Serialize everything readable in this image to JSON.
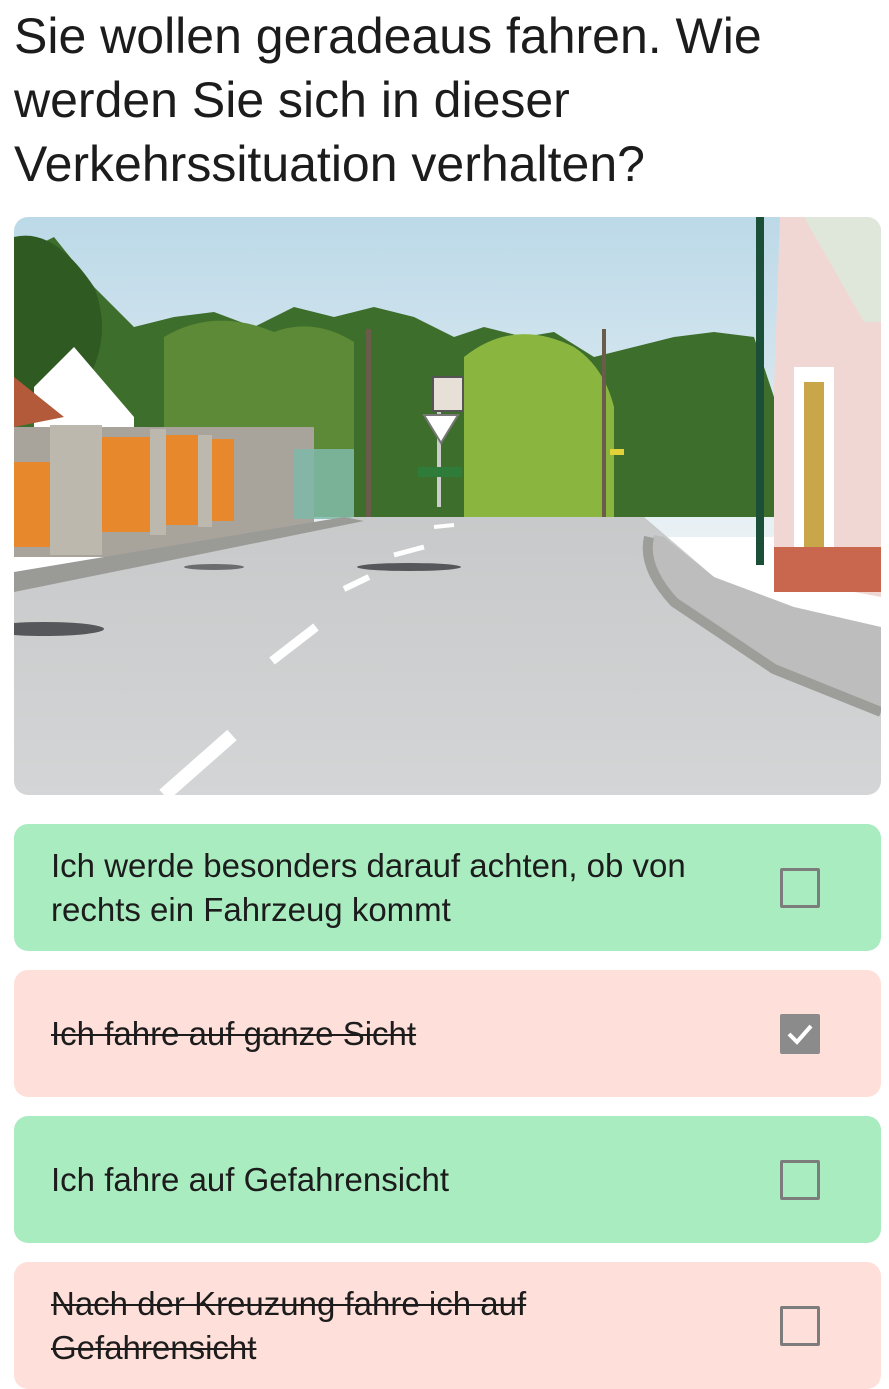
{
  "question": "Sie wollen geradeaus fahren. Wie werden Sie sich in dieser Verkehrssituation verhalten?",
  "image": {
    "icon": "road-intersection-photo",
    "scene": "village road with yield sign ahead"
  },
  "answers": [
    {
      "text": "Ich werde besonders darauf achten, ob von rechts ein Fahrzeug kommt",
      "status": "correct",
      "checked": false
    },
    {
      "text": "Ich fahre auf ganze Sicht",
      "status": "wrong",
      "checked": true
    },
    {
      "text": "Ich fahre auf Gefahrensicht",
      "status": "correct",
      "checked": false
    },
    {
      "text": "Nach der Kreuzung fahre ich auf Gefahrensicht",
      "status": "wrong",
      "checked": false
    }
  ],
  "colors": {
    "correct_bg": "#a9ecc0",
    "wrong_bg": "#ffdfda",
    "checkbox": "#7c7c7c"
  }
}
